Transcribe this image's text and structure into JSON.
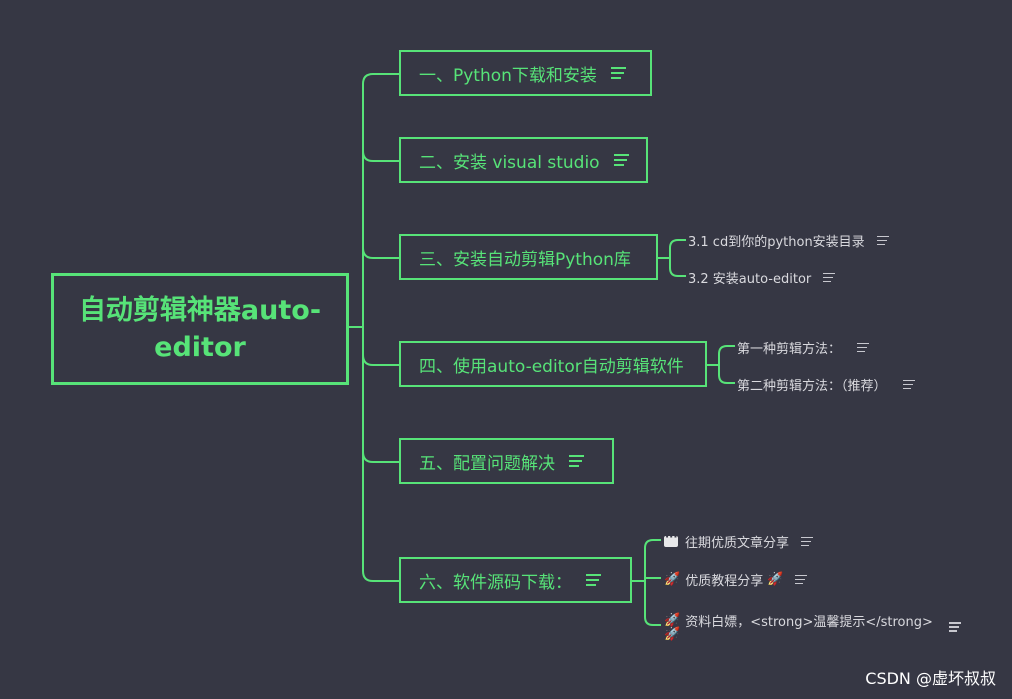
{
  "root": {
    "title": "自动剪辑神器auto-editor"
  },
  "branches": [
    {
      "label": "一、Python下载和安装"
    },
    {
      "label": "二、安装 visual studio"
    },
    {
      "label": "三、安装自动剪辑Python库"
    },
    {
      "label": "四、使用auto-editor自动剪辑软件"
    },
    {
      "label": "五、配置问题解决"
    },
    {
      "label": "六、软件源码下载："
    }
  ],
  "leaves": {
    "b3": [
      "3.1 cd到你的python安装目录",
      "3.2 安装auto-editor"
    ],
    "b4": [
      "第一种剪辑方法：",
      "第二种剪辑方法：（推荐）"
    ],
    "b6": [
      "往期优质文章分享",
      "优质教程分享",
      "资料白嫖，<strong>温馨提示</strong>"
    ]
  },
  "icons": {
    "menu": "notes-icon",
    "comment": "speech-bubble-icon",
    "rocket": "rocket-icon"
  },
  "colors": {
    "background": "#363744",
    "accent": "#57e378",
    "leaf_text": "#d9d9de"
  },
  "watermark": "CSDN @虚坏叔叔"
}
